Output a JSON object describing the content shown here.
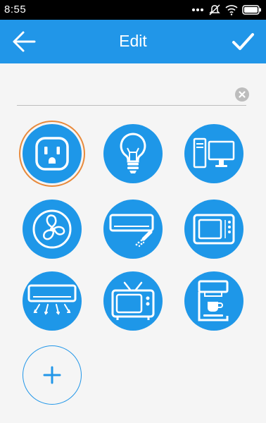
{
  "status_bar": {
    "time": "8:55",
    "icons": [
      "more-dots-icon",
      "mute-icon",
      "wifi-icon",
      "battery-icon"
    ]
  },
  "app_bar": {
    "title": "Edit",
    "back_icon": "arrow-left-icon",
    "confirm_icon": "checkmark-icon",
    "background": "#2196e8"
  },
  "name_field": {
    "value": "",
    "clear_icon": "clear-circle-icon"
  },
  "devices": [
    {
      "icon": "outlet-icon",
      "selected": true
    },
    {
      "icon": "light-bulb-icon",
      "selected": false
    },
    {
      "icon": "computer-icon",
      "selected": false
    },
    {
      "icon": "fan-icon",
      "selected": false
    },
    {
      "icon": "air-conditioner-icon",
      "selected": false
    },
    {
      "icon": "microwave-icon",
      "selected": false
    },
    {
      "icon": "air-conditioner-airflow-icon",
      "selected": false
    },
    {
      "icon": "television-icon",
      "selected": false
    },
    {
      "icon": "coffee-machine-icon",
      "selected": false
    }
  ],
  "add_button": {
    "icon": "plus-icon"
  },
  "colors": {
    "accent": "#2196e8",
    "tile": "#1e97e8",
    "selection_ring": "#e88a3c",
    "background": "#f5f5f5"
  }
}
